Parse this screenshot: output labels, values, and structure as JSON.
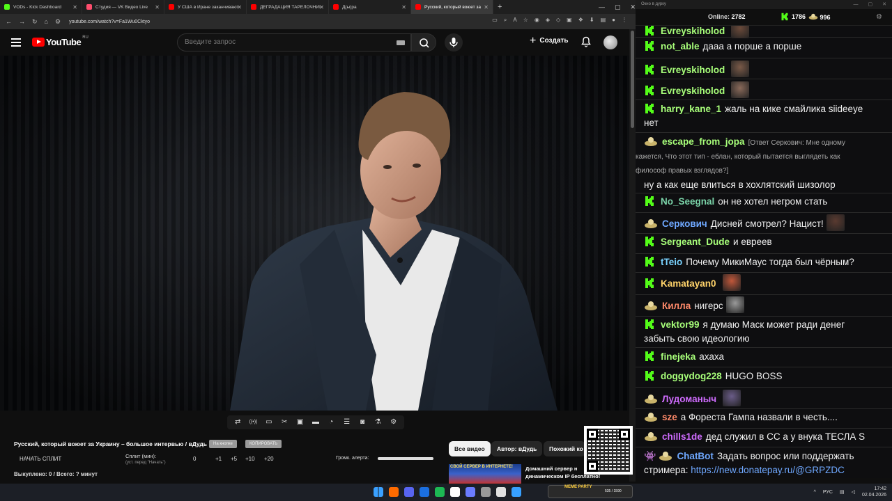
{
  "browser": {
    "tabs": [
      {
        "label": "VODs - Kick Dashboard",
        "color": "#53fc18"
      },
      {
        "label": "Студия — VK Видео Live",
        "color": "#ff4d6d"
      },
      {
        "label": "У США в Иране заканчиваются",
        "color": "#ff0000"
      },
      {
        "label": "ДЕГРАДАЦИЯ ТАРЕЛОЧНИЦ",
        "color": "#ff0000"
      },
      {
        "label": "Д(ы)ра",
        "color": "#ff0000"
      },
      {
        "label": "Русский, который воюет за",
        "color": "#ff0000"
      }
    ],
    "url": "youtube.com/watch?v=Fa1Wu0Cktyo"
  },
  "youtube": {
    "logo_text": "YouTube",
    "country_code": "RU",
    "search_placeholder": "Введите запрос",
    "create_label": "Создать"
  },
  "player_controls": [
    "repeat-icon",
    "live-icon",
    "cast-icon",
    "clip-icon",
    "miniplayer-icon",
    "theater-icon",
    "speed-icon",
    "transcript-icon",
    "screenshot-icon",
    "lab-icon",
    "settings-icon"
  ],
  "panel": {
    "video_title": "Русский, который воюет за Украину – большое интервью / вДудь",
    "timecode_btn": "На кнопке",
    "copy_btn": "КОПИРОВАТЬ",
    "start_split": "НАЧАТЬ СПЛИТ",
    "split_label": "Сплит (мин):",
    "split_sub": "(уст. перед \"Начать\")",
    "split_values": [
      "0",
      "+1",
      "+5",
      "+10",
      "+20"
    ],
    "bought": "Выкуплено: 0 / Всего: ? минут",
    "alert_volume_label": "Громк. алерта:",
    "alert_volume": 1.0
  },
  "chips": {
    "all": "Все видео",
    "author": "Автор: вДудь",
    "similar": "Похожий ко"
  },
  "recommendation": {
    "thumb_text": "СВОЙ СЕРВЕР В ИНТЕРНЕТЕ!",
    "title_line1": "Домашний сервер н",
    "title_line2": "динамическом IP бесплатно!"
  },
  "chat": {
    "title": "Окно в дурку",
    "online_label": "Online:",
    "online_count": "2782",
    "kick_count": "1786",
    "yt_count": "996",
    "messages": [
      {
        "platform": "kick",
        "user": "Evreyskiholod",
        "color": "#a8ff7a",
        "text": "",
        "emote": true
      },
      {
        "platform": "kick",
        "user": "not_able",
        "color": "#a8ff7a",
        "text": "дааа а порше а порше"
      },
      {
        "platform": "kick",
        "user": "Evreyskiholod",
        "color": "#a8ff7a",
        "text": "",
        "emote": true
      },
      {
        "platform": "kick",
        "user": "Evreyskiholod",
        "color": "#a8ff7a",
        "text": "",
        "emote": true
      },
      {
        "platform": "kick",
        "user": "harry_kane_1",
        "color": "#a8ff7a",
        "text": "жаль на кике смайлика siideeye",
        "text2": "нет"
      },
      {
        "platform": "yt",
        "user": "escape_from_jopa",
        "color": "#a8ff7a",
        "reply1": "[Ответ Серкович: Мне одному",
        "reply2": "кажется, Что этот тип - еблан, который пытается выглядеть как",
        "reply3": "философ правых взглядов?]",
        "text2": "ну а как еще влиться в хохлятский шизолор"
      },
      {
        "platform": "kick",
        "user": "No_Seegnal",
        "color": "#7ad3a8",
        "text": "он не хотел негром стать"
      },
      {
        "platform": "yt",
        "user": "Серкович",
        "color": "#6fa8ff",
        "text": "Дисней смотрел? Нацист!",
        "emote": true
      },
      {
        "platform": "kick",
        "user": "Sergeant_Dude",
        "color": "#a8ff7a",
        "text": "и евреев"
      },
      {
        "platform": "kick",
        "user": "tTeio",
        "color": "#7ad3ff",
        "text": "Почему МикиМаус тогда был чёрным?"
      },
      {
        "platform": "kick",
        "user": "Kamatayan0",
        "color": "#ffd36a",
        "text": "",
        "emote": true
      },
      {
        "platform": "yt",
        "user": "Килла",
        "color": "#ff8a6a",
        "text": "нигерс",
        "emote": true
      },
      {
        "platform": "kick",
        "user": "vektor99",
        "color": "#a8ff7a",
        "text": "я думаю Маск может ради денег",
        "text2": "забыть свою идеологию"
      },
      {
        "platform": "kick",
        "user": "finejeka",
        "color": "#a8ff7a",
        "text": "ахаха"
      },
      {
        "platform": "kick",
        "user": "doggydog228",
        "color": "#a8ff7a",
        "text": "HUGO BOSS"
      },
      {
        "platform": "yt",
        "user": "Лудоманыч",
        "color": "#d06cff",
        "text": "",
        "emote": true
      },
      {
        "platform": "yt",
        "user": "sze",
        "color": "#ff8a6a",
        "text": "а Фореста Гампа назвали в честь...."
      },
      {
        "platform": "yt",
        "user": "chills1de",
        "color": "#d06cff",
        "text": "дед служил в СС а у внука ТЕСЛА  S"
      },
      {
        "platform": "bot",
        "user": "ChatBot",
        "color": "#6fa8ff",
        "text": "Задать вопрос или поддержать",
        "text2_prefix": "стримера: ",
        "link": "https://new.donatepay.ru/@GRPZDC"
      }
    ]
  },
  "taskbar": {
    "lang": "РУС",
    "time": "17:42",
    "date": "02.04.2026",
    "widget_label": "MEME PARTY",
    "widget_count": "535 / 1590"
  }
}
